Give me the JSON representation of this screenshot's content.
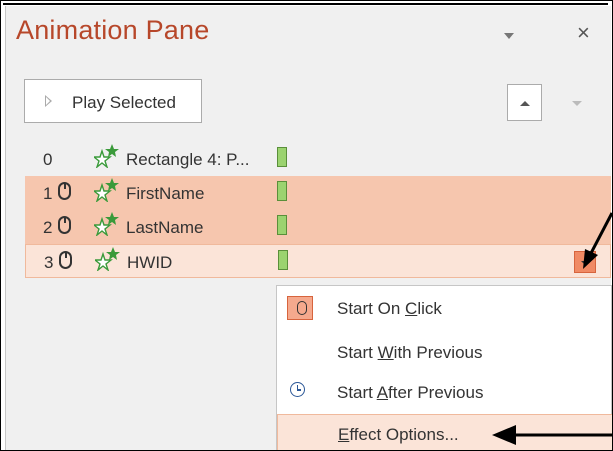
{
  "pane": {
    "title": "Animation Pane",
    "close_glyph": "×",
    "play_selected_label": "Play Selected"
  },
  "animations": [
    {
      "order": "0",
      "trigger": "",
      "label": "Rectangle 4: P..."
    },
    {
      "order": "1",
      "trigger": "mouse-click",
      "label": "FirstName"
    },
    {
      "order": "2",
      "trigger": "mouse-click",
      "label": "LastName"
    },
    {
      "order": "3",
      "trigger": "mouse-click",
      "label": "HWID"
    }
  ],
  "context_menu": {
    "items": [
      {
        "pre": "Start On ",
        "key": "C",
        "post": "lick",
        "icon": "mouse-click-icon"
      },
      {
        "pre": "Start ",
        "key": "W",
        "post": "ith Previous",
        "icon": ""
      },
      {
        "pre": "Start ",
        "key": "A",
        "post": "fter Previous",
        "icon": "clock-icon"
      },
      {
        "pre": "",
        "key": "E",
        "post": "ffect Options...",
        "icon": ""
      }
    ]
  },
  "colors": {
    "title": "#b7472a",
    "selected_row": "#f6c6ae",
    "hover_row": "#fbe4d8",
    "effect_star": "#3a9a3a",
    "timing_bar": "#9bd36f"
  }
}
